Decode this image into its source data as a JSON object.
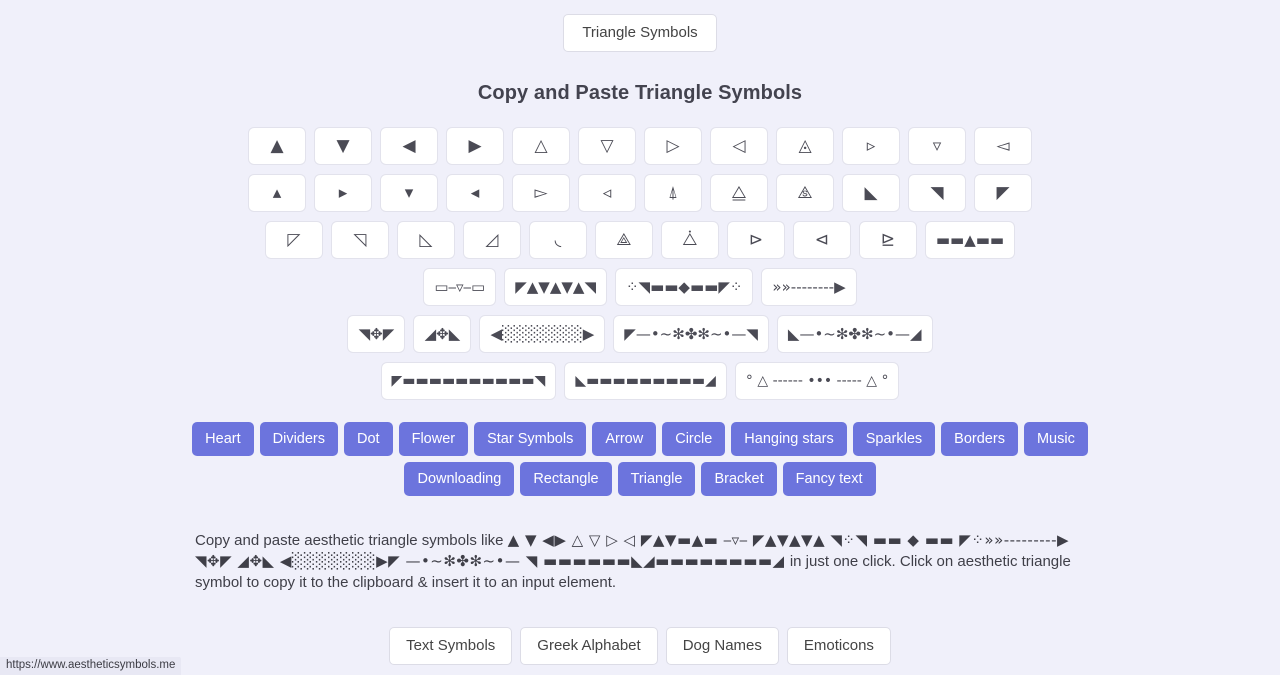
{
  "top_button": {
    "label": "Triangle Symbols"
  },
  "page_title": "Copy and Paste Triangle Symbols",
  "symbol_rows": [
    [
      "▲",
      "▼",
      "◀",
      "▶",
      "△",
      "▽",
      "▷",
      "◁",
      "◬",
      "▹",
      "▿",
      "◅"
    ],
    [
      "▴",
      "▸",
      "▾",
      "◂",
      "▻",
      "◃",
      "⍋",
      "⧋",
      "⧌",
      "◣",
      "◥",
      "◤"
    ],
    [
      "◸",
      "◹",
      "◺",
      "◿",
      "◟",
      "⟁",
      "⧊",
      "⊳",
      "⊲",
      "⊵",
      "▬▬▲▬▬"
    ],
    [
      "▭⎯▿⎯▭",
      "◤▲▼▲▼▲◥",
      "⁘◥▬▬◆▬▬◤⁘",
      "»»--------▶"
    ],
    [
      "◥✥◤",
      "◢✥◣",
      "◀░░░░░░░▶",
      "◤—•~✻✤✻~•—◥",
      "◣—•~✻✤✻~•—◢"
    ],
    [
      "◤▬▬▬▬▬▬▬▬▬▬◥",
      "◣▬▬▬▬▬▬▬▬▬◢",
      "° △ ------ ••• ----- △ °"
    ]
  ],
  "categories": [
    [
      "Heart",
      "Dividers",
      "Dot",
      "Flower",
      "Star Symbols",
      "Arrow",
      "Circle",
      "Hanging stars",
      "Sparkles",
      "Borders",
      "Music"
    ],
    [
      "Downloading",
      "Rectangle",
      "Triangle",
      "Bracket",
      "Fancy text"
    ]
  ],
  "description": {
    "lead": "Copy and paste aesthetic triangle symbols like ",
    "glyphs": "▲ ▼ ◀▶ △ ▽ ▷ ◁ ◤▲▼▬▲▬ ⎯▿⎯ ◤▲▼▲▼▲ ◥⁘◥ ▬▬ ◆ ▬▬ ◤⁘»»---------▶ ◥✥◤ ◢✥◣ ◀░░░░░░░▶◤ —•~✻✤✻~•— ◥ ▬▬▬▬▬▬◣◢▬▬▬▬▬▬▬▬◢ ",
    "mid": "in just one click. Click on aesthetic triangle symbol to copy it to the clipboard & insert it to an input element."
  },
  "footer_buttons": [
    "Text Symbols",
    "Greek Alphabet",
    "Dog Names",
    "Emoticons"
  ],
  "status_bar": {
    "url": "https://www.aestheticsymbols.me"
  },
  "colors": {
    "page_bg": "#f0f0fa",
    "accent": "#6c74dd",
    "card_bg": "#ffffff",
    "text": "#3f3f48"
  }
}
